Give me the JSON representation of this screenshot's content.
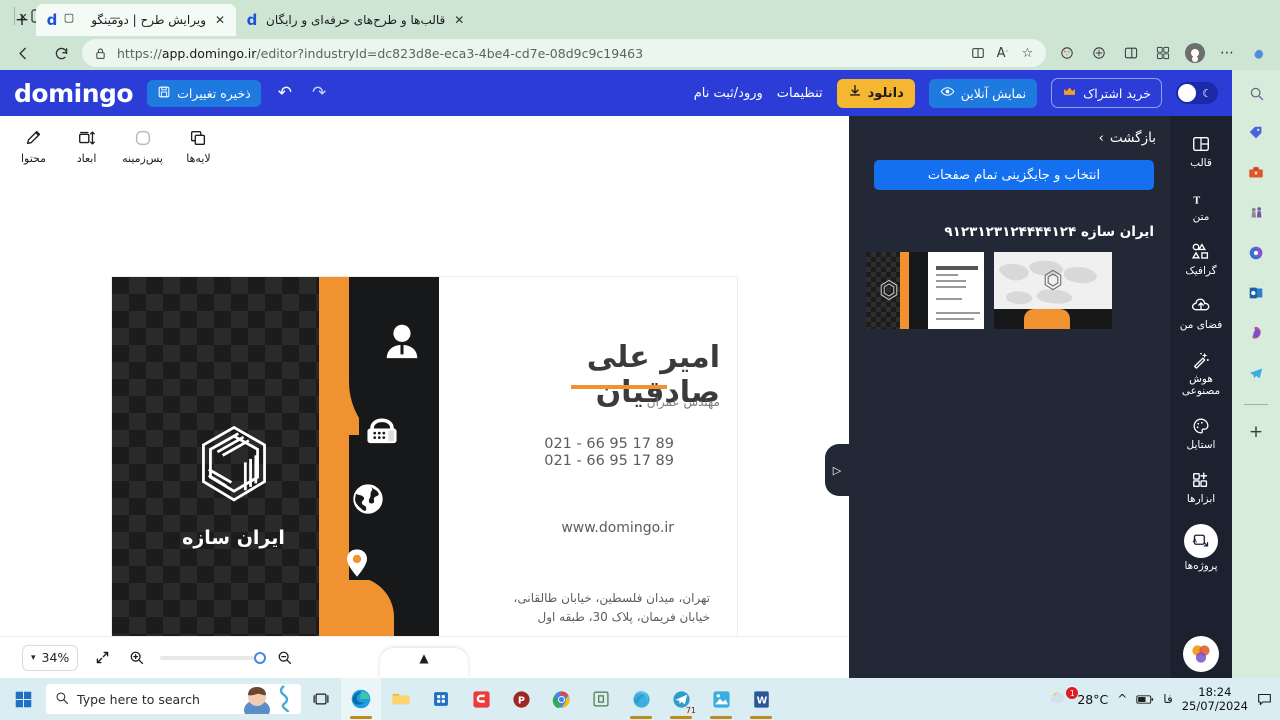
{
  "browser": {
    "tabs": [
      {
        "title": "ویرایش طرح | دومینگو",
        "favicon": "d",
        "active": true,
        "close": "✕"
      },
      {
        "title": "قالب‌ها و طرح‌های حرفه‌ای و رایگان",
        "favicon": "d",
        "active": false,
        "close": "✕"
      }
    ],
    "new_tab_label": "+",
    "window_controls": {
      "minimize": "—",
      "maximize": "▢",
      "close": "✕"
    },
    "address": {
      "url_scheme": "https://",
      "url_host": "app.domingo.ir",
      "url_path": "/editor?industryId=dc823d8e-eca3-4be4-cd7e-08d9c9c19463",
      "lock_icon": "lock-icon"
    },
    "toolbar_icons": [
      "split-screen-icon",
      "read-aloud-icon",
      "favorite-star-icon",
      "browser-essentials-icon",
      "collections-icon",
      "split-view-icon",
      "profile-icon",
      "settings-more-icon",
      "copilot-icon"
    ],
    "sidebar_icons": [
      "search-icon",
      "shopping-tag-icon",
      "tools-icon",
      "games-icon",
      "microsoft-365-icon",
      "outlook-icon",
      "designer-icon",
      "telegram-icon",
      "add-sidebar-icon"
    ]
  },
  "app_header": {
    "brand": "domingo",
    "save_label": "ذخیره تغییرات",
    "undo_icon": "undo-icon",
    "redo_icon": "redo-icon",
    "dark_mode_toggle": "dark-mode-toggle",
    "subscribe_label": "خرید اشتراک",
    "preview_label": "نمایش آنلاین",
    "download_label": "دانلود",
    "settings_label": "تنظیمات",
    "login_label": "ورود/ثبت نام"
  },
  "tool_strip": [
    {
      "label": "محتوا",
      "icon": "content-edit-icon"
    },
    {
      "label": "ابعاد",
      "icon": "dimensions-icon"
    },
    {
      "label": "پس‌زمینه",
      "icon": "background-icon"
    },
    {
      "label": "لایه‌ها",
      "icon": "layers-icon"
    }
  ],
  "canvas": {
    "card": {
      "logo_caption": "ایران سازه",
      "name": "امیر علی صادقیان",
      "role": "مهندس عمران",
      "phone1": "021 - 66 95 17 89",
      "phone2": "021 - 66 95 17 89",
      "website": "www.domingo.ir",
      "address_line1": "تهران، میدان فلسطین، خیابان طالقانی،",
      "address_line2": "خیابان فریمان، پلاک 30، طبقه اول",
      "icons": [
        "person-icon",
        "telephone-icon",
        "globe-icon",
        "location-pin-icon"
      ],
      "accent_color": "#f0922f",
      "dark_color": "#17181a"
    },
    "help_button": "؟"
  },
  "zoom_bar": {
    "zoom_value": "34%",
    "chevron": "chevron-down-icon",
    "fit_icon": "fit-screen-icon",
    "zoom_in_icon": "zoom-in-icon",
    "zoom_out_icon": "zoom-out-icon",
    "pages_toggle_icon": "chevron-up-icon"
  },
  "side_panel": {
    "back_label": "بازگشت",
    "back_chevron": "›",
    "replace_all_label": "انتخاب و جایگزینی تمام صفحات",
    "group_title": "ایران سازه ۹۱۲۳۱۲۳۱۲۴۴۴۴۱۲۴",
    "thumbnails": [
      {
        "name": "card-front-thumbnail"
      },
      {
        "name": "card-back-thumbnail"
      }
    ],
    "collapse_icon": "collapse-panel-icon"
  },
  "app_rail": [
    {
      "label": "قالب",
      "icon": "template-icon",
      "active": false
    },
    {
      "label": "متن",
      "icon": "text-icon",
      "active": false
    },
    {
      "label": "گرافیک",
      "icon": "graphic-icon",
      "active": false
    },
    {
      "label": "فضای من",
      "icon": "my-space-icon",
      "active": false
    },
    {
      "label": "هوش مصنوعی",
      "icon": "ai-magic-icon",
      "active": false
    },
    {
      "label": "استایل",
      "icon": "style-palette-icon",
      "active": false
    },
    {
      "label": "ابزارها",
      "icon": "tools-grid-icon",
      "active": false
    },
    {
      "label": "پروژه‌ها",
      "icon": "projects-icon",
      "active": true
    }
  ],
  "taskbar": {
    "start_icon": "windows-start-icon",
    "search_placeholder": "Type here to search",
    "task_view_icon": "task-view-icon",
    "apps": [
      "edge-icon",
      "file-explorer-icon",
      "microsoft-store-icon",
      "camtasia-icon",
      "photoscape-icon",
      "chrome-icon",
      "evernote-icon",
      "internet-download-manager-icon",
      "telegram-icon",
      "photos-icon",
      "word-icon"
    ],
    "telegram_badge": "71",
    "weather_temp": "28°C",
    "weather_badge": "1",
    "tray_chevron": "^",
    "battery_icon": "battery-icon",
    "language": "فا",
    "time": "18:24",
    "date": "25/07/2024",
    "notification_icon": "notification-icon"
  }
}
